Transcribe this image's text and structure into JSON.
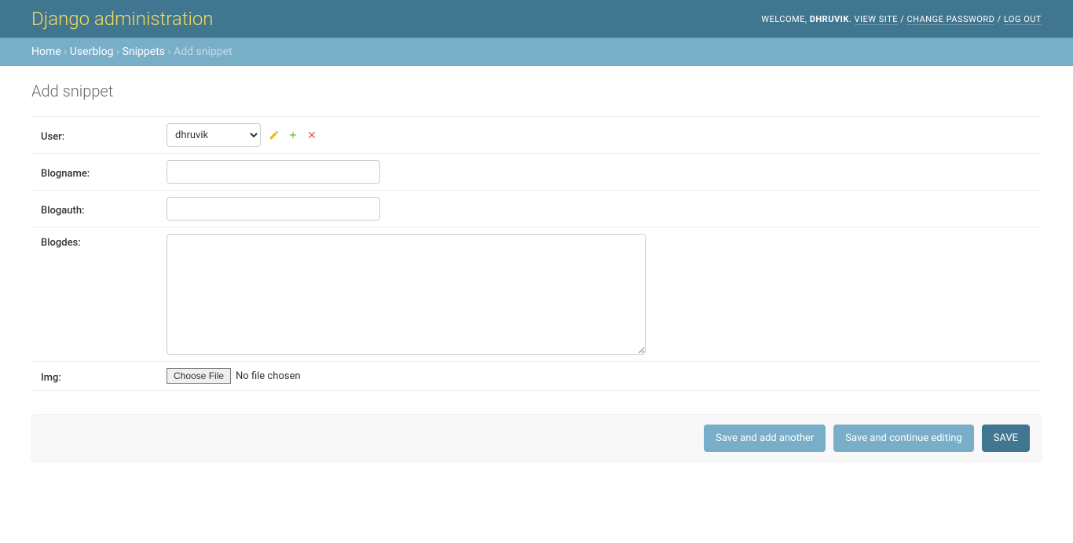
{
  "header": {
    "site_title": "Django administration",
    "welcome": "WELCOME, ",
    "username": "DHRUVIK",
    "view_site": "VIEW SITE",
    "change_password": "CHANGE PASSWORD",
    "log_out": "LOG OUT"
  },
  "breadcrumbs": {
    "home": "Home",
    "app": "Userblog",
    "model": "Snippets",
    "current": "Add snippet"
  },
  "page": {
    "title": "Add snippet"
  },
  "form": {
    "user": {
      "label": "User:",
      "selected": "dhruvik"
    },
    "blogname": {
      "label": "Blogname:",
      "value": ""
    },
    "blogauth": {
      "label": "Blogauth:",
      "value": ""
    },
    "blogdes": {
      "label": "Blogdes:",
      "value": ""
    },
    "img": {
      "label": "Img:",
      "button": "Choose File",
      "status": "No file chosen"
    }
  },
  "buttons": {
    "save_add": "Save and add another",
    "save_continue": "Save and continue editing",
    "save": "SAVE"
  }
}
